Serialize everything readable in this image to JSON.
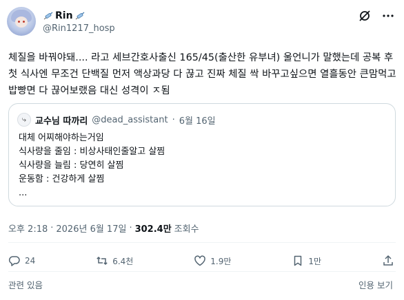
{
  "author": {
    "display_name": "Rin",
    "handle": "@Rin1217_hosp",
    "avatar_icon": "anime-avatar",
    "name_emoji": "syringe-icon"
  },
  "tweet": {
    "text": "체질을 바꿔야돼.... 라고 세브간호사출신 165/45(출산한 유부녀) 울언니가 말했는데 공복 후 첫 식사엔 무조건 단백질 먼저 액상과당 다 끊고 진짜 체질 싹 바꾸고싶으면 열흘동안 큰맘먹고 밥빵면 다 끊어보랬음 대신 성격이 ㅈ됨"
  },
  "quoted": {
    "name": "교수님 따까리",
    "handle": "@dead_assistant",
    "separator": "·",
    "date": "6월 16일",
    "body": "대체 어찌해야하는거임\n식사량을 줄임 : 비상사태인줄알고 살찜\n식사량을 늘림 : 당연히 살찜\n운동함 : 건강하게 살찜\n..."
  },
  "meta": {
    "time": "오후 2:18",
    "sep1": "·",
    "date": "2026년 6월 17일",
    "sep2": "·",
    "views": "302.4만",
    "views_label": "조회수"
  },
  "actions": {
    "reply_count": "24",
    "retweet_count": "6.4천",
    "like_count": "1.9만",
    "bookmark_count": "1만"
  },
  "footer": {
    "related": "관련 있음",
    "view_more": "인용 보기"
  },
  "colors": {
    "text": "#0f1419",
    "muted": "#536471",
    "border": "#cfd9de"
  }
}
